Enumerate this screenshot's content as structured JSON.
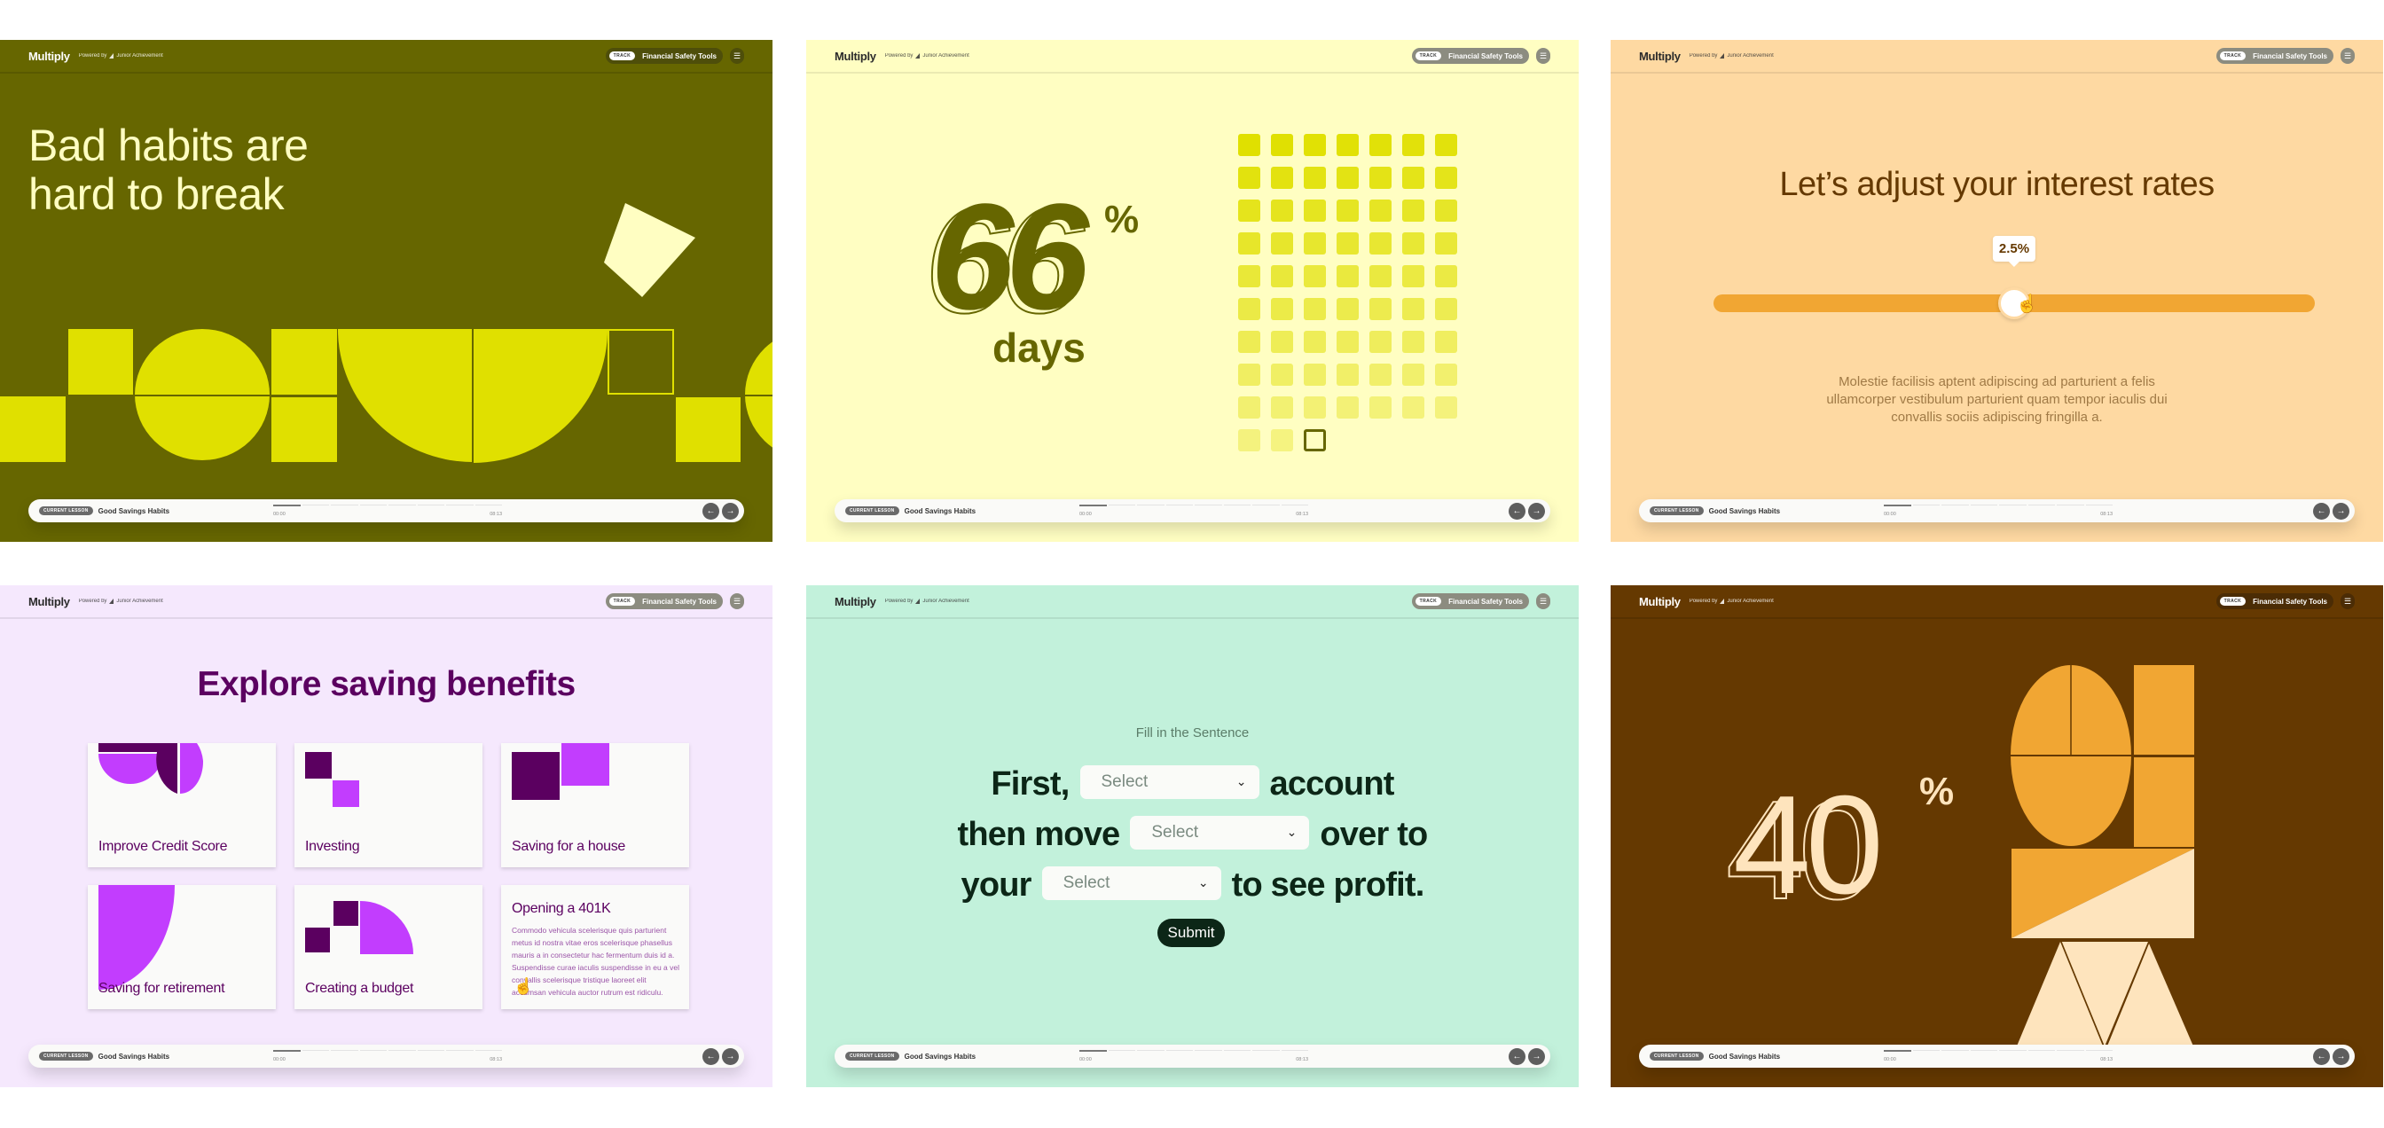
{
  "common": {
    "logo": "Multiply",
    "powered_by": "Powered by",
    "partner": "Junior Achievement",
    "track_badge": "TRACK",
    "track_name": "Financial Safety Tools",
    "menu_icon": "☰",
    "lesson_badge": "CURRENT LESSON",
    "lesson_title": "Good Savings Habits",
    "time_start": "00:00",
    "time_end": "08:13",
    "progress_segments": 8,
    "progress_filled": 1,
    "prev_icon": "←",
    "next_icon": "→"
  },
  "slides": {
    "bad_habits": {
      "title_line1": "Bad habits are",
      "title_line2": "hard to break",
      "colors": {
        "bg": "#666600",
        "accent": "#e0e000",
        "highlight": "#fffec2"
      }
    },
    "days": {
      "number": "66",
      "percent_sign": "%",
      "label": "days",
      "grid_total_filled": 65,
      "grid_outlined_index": 66,
      "colors": {
        "bg": "#fffec2",
        "text": "#666600",
        "cell": "#e0e000"
      }
    },
    "interest": {
      "title": "Let’s adjust your interest rates",
      "slider_value_label": "2.5%",
      "slider_fraction": 0.5,
      "body": "Molestie facilisis aptent adipiscing ad parturient a felis ullamcorper vestibulum parturient quam tempor iaculis dui convallis sociis adipiscing fringilla a.",
      "colors": {
        "bg": "#fed9a2",
        "track": "#f1a633",
        "text": "#653901"
      }
    },
    "explore": {
      "title": "Explore saving benefits",
      "cards": [
        {
          "label": "Improve Credit Score"
        },
        {
          "label": "Investing"
        },
        {
          "label": "Saving for a house"
        },
        {
          "label": "Saving for retirement"
        },
        {
          "label": "Creating a budget"
        },
        {
          "label": "Opening a 401K",
          "description": "Commodo vehicula scelerisque quis parturient metus id nostra vitae eros scelerisque phasellus mauris a in consectetur hac fermentum duis id a. Suspendisse curae iaculis suspendisse in eu a vel convallis scelerisque tristique laoreet elit accumsan vehicula auctor rutrum est ridiculu."
        }
      ],
      "colors": {
        "bg": "#f5e8fd",
        "dark": "#5b0060",
        "bright": "#c23dfe"
      }
    },
    "fill_sentence": {
      "kicker": "Fill in the Sentence",
      "part1": "First,",
      "part2": "account",
      "part3": "then move",
      "part4": "over to",
      "part5": "your",
      "part6": "to see profit.",
      "select_placeholder": "Select",
      "submit_label": "Submit",
      "colors": {
        "bg": "#c2f1db",
        "text": "#0c2617"
      }
    },
    "forty": {
      "number": "40",
      "percent_sign": "%",
      "colors": {
        "bg": "#653901",
        "accent": "#f1a633",
        "light": "#fee4bd"
      }
    }
  }
}
